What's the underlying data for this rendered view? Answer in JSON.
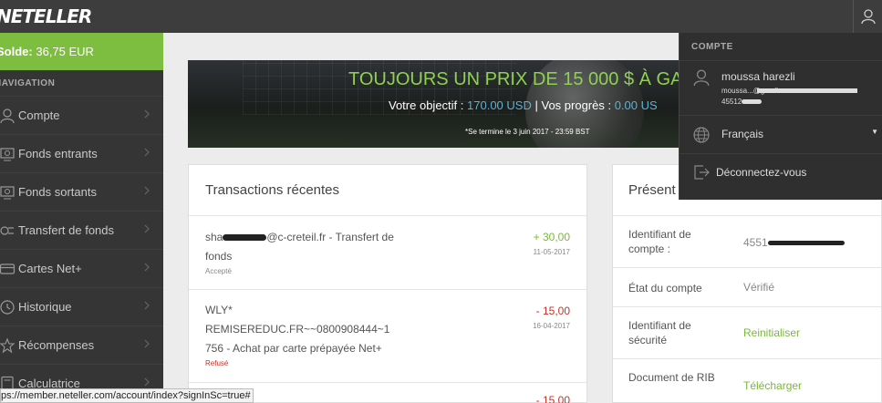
{
  "header": {
    "logo": "NETELLER",
    "user_icon": "user-icon"
  },
  "sidebar": {
    "balance_label": "Solde:",
    "balance_value": "36,75 EUR",
    "nav_title": "NAVIGATION",
    "items": [
      {
        "label": "Compte",
        "icon": "user-icon"
      },
      {
        "label": "Fonds entrants",
        "icon": "money-in-icon"
      },
      {
        "label": "Fonds sortants",
        "icon": "money-out-icon"
      },
      {
        "label": "Transfert de fonds",
        "icon": "transfer-icon"
      },
      {
        "label": "Cartes Net+",
        "icon": "card-icon"
      },
      {
        "label": "Historique",
        "icon": "clock-icon"
      },
      {
        "label": "Récompenses",
        "icon": "rewards-icon"
      },
      {
        "label": "Calculatrice",
        "icon": "calculator-icon"
      }
    ]
  },
  "banner": {
    "title": "TOUJOURS UN PRIX DE 15 000 $ À GA",
    "objective_label": "Votre objectif :",
    "objective_value": "170.00 USD",
    "separator": "|",
    "progress_label": "Vos progrès :",
    "progress_value": "0.00 US",
    "note": "*Se termine le 3 juin 2017 - 23:59 BST"
  },
  "transactions": {
    "title": "Transactions récentes",
    "rows": [
      {
        "desc_prefix": "sha",
        "desc_suffix": "@c-creteil.fr - Transfert de fonds",
        "status": "Accepté",
        "amount": "+ 30,00",
        "date": "11-05-2017",
        "type": "credit"
      },
      {
        "desc": "WLY* REMISEREDUC.FR~~0800908444~1 756 - Achat par carte prépayée Net+",
        "status": "Refusé",
        "amount": "- 15,00",
        "date": "16-04-2017",
        "type": "debit"
      },
      {
        "desc": "",
        "status": "",
        "amount": "- 15,00",
        "date": "",
        "type": "debit"
      }
    ]
  },
  "presentation": {
    "title": "Présent",
    "rows": [
      {
        "label": "Identifiant de compte :",
        "value": "4551",
        "link": false
      },
      {
        "label": "État du compte",
        "value": "Vérifié",
        "link": false
      },
      {
        "label": "Identifiant de sécurité",
        "value": "Reinitialiser",
        "link": true
      },
      {
        "label": "Document de RIB",
        "value": "Télécharger",
        "link": true
      }
    ]
  },
  "account_menu": {
    "title": "COMPTE",
    "user_name": "moussa harezli",
    "user_email": "moussa...@gmail.com",
    "user_id": "45512",
    "language": "Français",
    "logout": "Déconnectez-vous"
  },
  "statusbar": {
    "url": "ps://member.neteller.com/account/index?signInSc=true#"
  },
  "colors": {
    "brand_green": "#7dbd3f",
    "credit": "#7ab83a",
    "debit": "#c4332a",
    "topbar": "#3d3d3d",
    "sidebar": "#353535"
  }
}
